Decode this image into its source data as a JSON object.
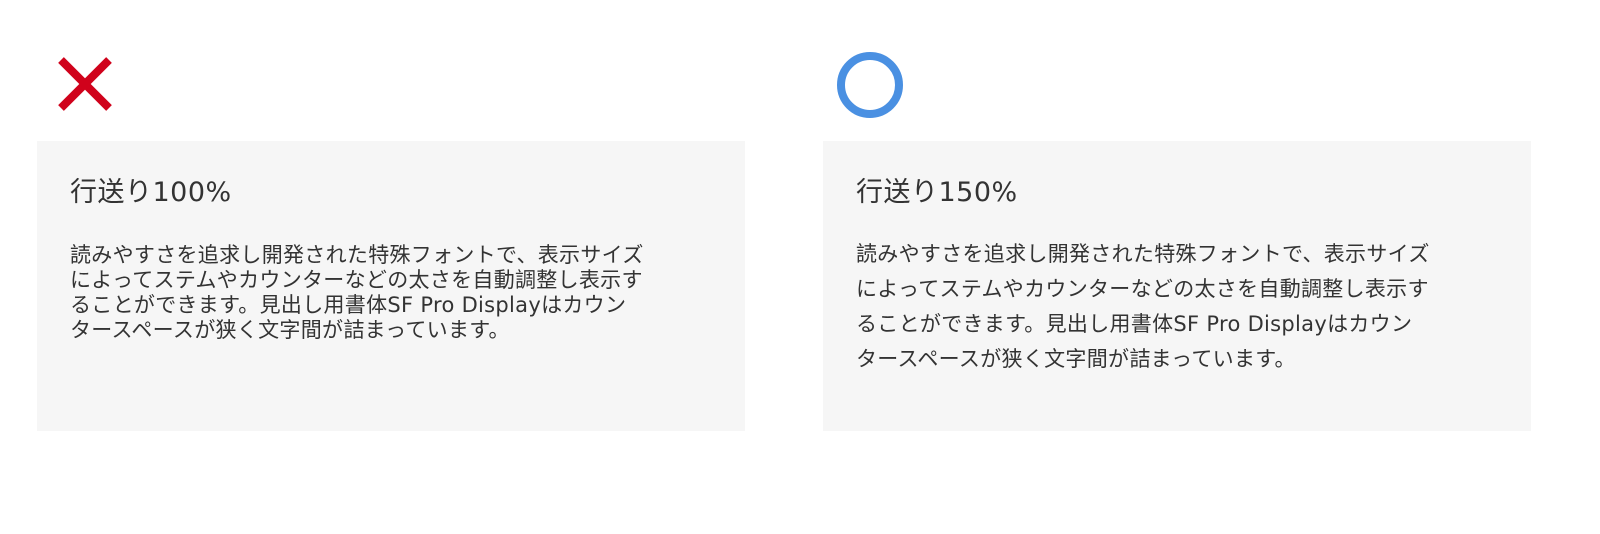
{
  "examples": [
    {
      "verdict_icon": "cross-icon",
      "verdict_color": "#d0021b",
      "title": "行送り100%",
      "lines": [
        "読みやすさを追求し開発された特殊フォントで、表示サイズ",
        "によってステムやカウンターなどの太さを自動調整し表示す",
        "ることができます。見出し用書体SF Pro Displayはカウン",
        "タースペースが狭く文字間が詰まっています。"
      ]
    },
    {
      "verdict_icon": "circle-icon",
      "verdict_color": "#4a90e2",
      "title": "行送り150%",
      "lines": [
        "読みやすさを追求し開発された特殊フォントで、表示サイズ",
        "によってステムやカウンターなどの太さを自動調整し表示す",
        "ることができます。見出し用書体SF Pro Displayはカウン",
        "タースペースが狭く文字間が詰まっています。"
      ]
    }
  ]
}
